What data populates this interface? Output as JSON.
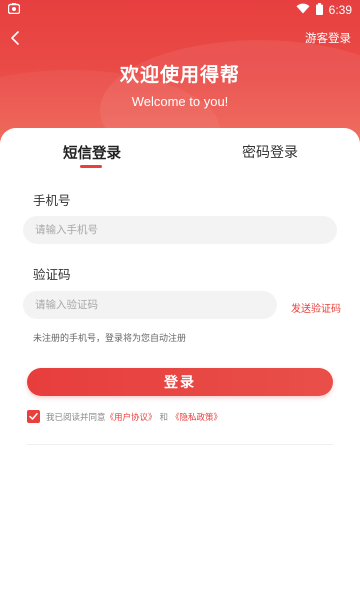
{
  "status_bar": {
    "time": "6:39"
  },
  "nav": {
    "guest_login": "游客登录"
  },
  "header": {
    "title": "欢迎使用得帮",
    "subtitle": "Welcome to you!"
  },
  "tabs": [
    {
      "label": "短信登录",
      "active": true
    },
    {
      "label": "密码登录",
      "active": false
    }
  ],
  "form": {
    "phone_label": "手机号",
    "phone_placeholder": "请输入手机号",
    "code_label": "验证码",
    "code_placeholder": "请输入验证码",
    "send_code": "发送验证码",
    "hint": "未注册的手机号，登录将为您自动注册",
    "login_button": "登录"
  },
  "agreement": {
    "checked": true,
    "prefix": "我已阅读并同意",
    "user_agreement": "《用户协议》",
    "and": "和",
    "privacy_policy": "《隐私政策》"
  },
  "colors": {
    "accent": "#e8403c",
    "header": "#e73f3f"
  }
}
